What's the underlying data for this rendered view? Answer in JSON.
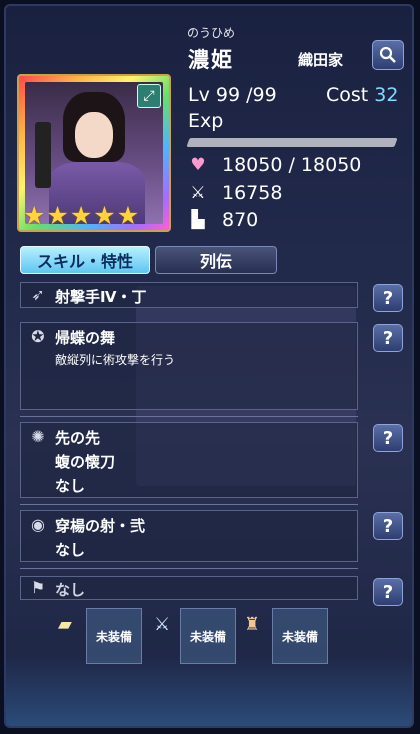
{
  "header": {
    "furigana": "のうひめ",
    "name": "濃姫",
    "clan": "織田家"
  },
  "stats": {
    "level_label": "Lv",
    "level": "99",
    "level_max": "/99",
    "cost_label": "Cost",
    "cost": "32",
    "exp_label": "Exp",
    "exp_fraction": 1.0,
    "hp": "18050 / 18050",
    "attack": "16758",
    "speed": "870",
    "stars": 5
  },
  "tabs": {
    "skills": "スキル・特性",
    "biography": "列伝"
  },
  "skills": [
    {
      "title": "射撃手Ⅳ・丁",
      "lines": []
    },
    {
      "title": "帰蝶の舞",
      "lines": [
        "敵縦列に術攻撃を行う"
      ]
    },
    {
      "title": "先の先",
      "lines": [
        "蝮の懐刀",
        "なし"
      ]
    },
    {
      "title": "穿楊の射・弐",
      "lines": [
        "なし"
      ]
    },
    {
      "title": "なし",
      "lines": []
    }
  ],
  "equipment": [
    "未装備",
    "未装備",
    "未装備"
  ],
  "icons": [
    "search-icon",
    "expand-icon",
    "heart-icon",
    "sword-icon",
    "boot-icon",
    "help-icon"
  ],
  "colors": {
    "accent": "#7fdcff",
    "star": "#ffd43b",
    "tab_active": "#5ec6f0"
  }
}
